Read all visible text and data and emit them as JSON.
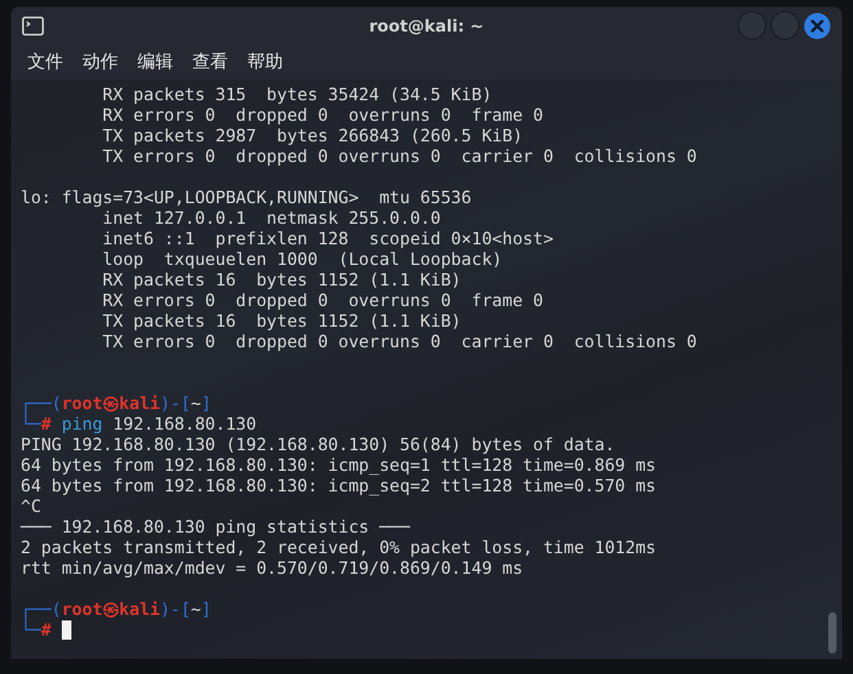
{
  "window": {
    "title": "root@kali: ~"
  },
  "menu": [
    {
      "label": "文件"
    },
    {
      "label": "动作"
    },
    {
      "label": "编辑"
    },
    {
      "label": "查看"
    },
    {
      "label": "帮助"
    }
  ],
  "terminal": {
    "lines": [
      {
        "kind": "output",
        "text": "        RX packets 315  bytes 35424 (34.5 KiB)"
      },
      {
        "kind": "output",
        "text": "        RX errors 0  dropped 0  overruns 0  frame 0"
      },
      {
        "kind": "output",
        "text": "        TX packets 2987  bytes 266843 (260.5 KiB)"
      },
      {
        "kind": "output",
        "text": "        TX errors 0  dropped 0 overruns 0  carrier 0  collisions 0"
      },
      {
        "kind": "blank"
      },
      {
        "kind": "output",
        "text": "lo: flags=73<UP,LOOPBACK,RUNNING>  mtu 65536"
      },
      {
        "kind": "output",
        "text": "        inet 127.0.0.1  netmask 255.0.0.0"
      },
      {
        "kind": "output",
        "text": "        inet6 ::1  prefixlen 128  scopeid 0×10<host>"
      },
      {
        "kind": "output",
        "text": "        loop  txqueuelen 1000  (Local Loopback)"
      },
      {
        "kind": "output",
        "text": "        RX packets 16  bytes 1152 (1.1 KiB)"
      },
      {
        "kind": "output",
        "text": "        RX errors 0  dropped 0  overruns 0  frame 0"
      },
      {
        "kind": "output",
        "text": "        TX packets 16  bytes 1152 (1.1 KiB)"
      },
      {
        "kind": "output",
        "text": "        TX errors 0  dropped 0 overruns 0  carrier 0  collisions 0"
      },
      {
        "kind": "blank"
      },
      {
        "kind": "blank"
      },
      {
        "kind": "prompt",
        "frame_top": "┌──(",
        "user": "root",
        "symbol": "㉿",
        "host": "kali",
        "frame_mid": ")-[",
        "dir": "~",
        "frame_end": "]",
        "frame_bottom": "└─",
        "sign": "#",
        "command": "ping",
        "args": " 192.168.80.130"
      },
      {
        "kind": "output",
        "text": "PING 192.168.80.130 (192.168.80.130) 56(84) bytes of data."
      },
      {
        "kind": "output",
        "text": "64 bytes from 192.168.80.130: icmp_seq=1 ttl=128 time=0.869 ms"
      },
      {
        "kind": "output",
        "text": "64 bytes from 192.168.80.130: icmp_seq=2 ttl=128 time=0.570 ms"
      },
      {
        "kind": "output",
        "text": "^C"
      },
      {
        "kind": "output",
        "text": "─── 192.168.80.130 ping statistics ───"
      },
      {
        "kind": "output",
        "text": "2 packets transmitted, 2 received, 0% packet loss, time 1012ms"
      },
      {
        "kind": "output",
        "text": "rtt min/avg/max/mdev = 0.570/0.719/0.869/0.149 ms"
      },
      {
        "kind": "blank"
      },
      {
        "kind": "prompt",
        "frame_top": "┌──(",
        "user": "root",
        "symbol": "㉿",
        "host": "kali",
        "frame_mid": ")-[",
        "dir": "~",
        "frame_end": "]",
        "frame_bottom": "└─",
        "sign": "#",
        "cursor": true
      }
    ]
  }
}
